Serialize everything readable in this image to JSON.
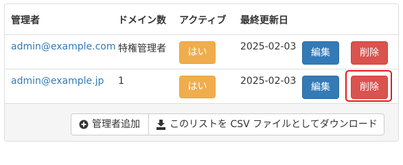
{
  "table": {
    "headers": {
      "admin": "管理者",
      "domains": "ドメイン数",
      "active": "アクティブ",
      "updated": "最終更新日"
    },
    "rows": [
      {
        "email": "admin@example.com",
        "domains": "特権管理者",
        "active": "はい",
        "updated": "2025-02-03",
        "edit_label": "編集",
        "delete_label": "削除"
      },
      {
        "email": "admin@example.jp",
        "domains": "1",
        "active": "はい",
        "updated": "2025-02-03",
        "edit_label": "編集",
        "delete_label": "削除"
      }
    ]
  },
  "footer": {
    "add_admin_label": "管理者追加",
    "csv_download_label": "このリストを CSV ファイルとしてダウンロード"
  },
  "icons": {
    "add": "plus-circle-icon",
    "download": "download-icon"
  },
  "colors": {
    "link": "#337ab7",
    "badge_warning": "#f0ad4e",
    "edit_button": "#337ab7",
    "delete_button": "#d9534f",
    "highlight": "#e8191a"
  }
}
